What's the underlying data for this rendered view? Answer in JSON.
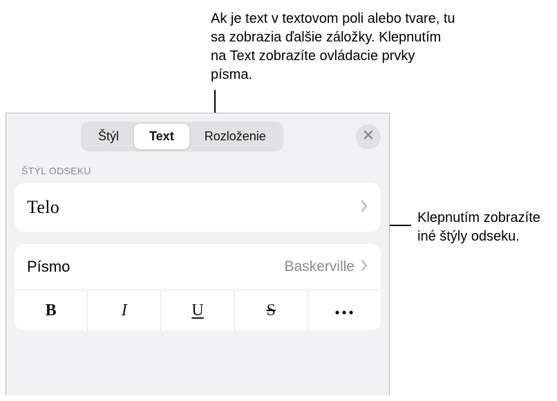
{
  "callouts": {
    "top": "Ak je text v textovom poli alebo tvare, tu sa zobrazia ďalšie záložky. Klepnutím na Text zobrazíte ovládacie prvky písma.",
    "right": "Klepnutím zobrazíte iné štýly odseku."
  },
  "tabs": {
    "style": "Štýl",
    "text": "Text",
    "layout": "Rozloženie"
  },
  "section_label": "ŠTÝL ODSEKU",
  "paragraph_style": {
    "value": "Telo"
  },
  "font_row": {
    "label": "Písmo",
    "value": "Baskerville"
  },
  "style_buttons": {
    "bold": "B",
    "italic": "I",
    "underline": "U",
    "strike": "S",
    "more": "···"
  },
  "icons": {
    "close": "close",
    "chevron_right": "chevron-right"
  }
}
